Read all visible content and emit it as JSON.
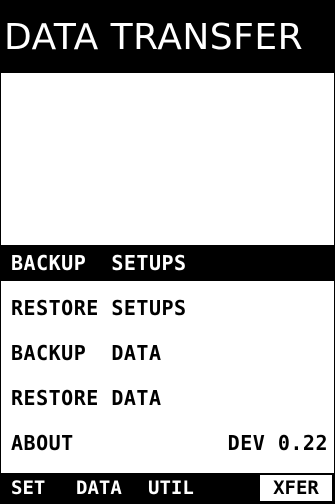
{
  "title": "DATA TRANSFER",
  "menu": {
    "items": [
      {
        "label": "BACKUP  SETUPS",
        "value": ""
      },
      {
        "label": "RESTORE SETUPS",
        "value": ""
      },
      {
        "label": "BACKUP  DATA",
        "value": ""
      },
      {
        "label": "RESTORE DATA",
        "value": ""
      },
      {
        "label": "ABOUT",
        "value": "DEV 0.22"
      }
    ],
    "selected_index": 0
  },
  "tabs": [
    {
      "label": "SET"
    },
    {
      "label": "DATA"
    },
    {
      "label": "UTIL"
    },
    {
      "label": "XFER"
    }
  ],
  "active_tab": "XFER",
  "colors": {
    "background": "#ffffff",
    "foreground": "#000000"
  }
}
